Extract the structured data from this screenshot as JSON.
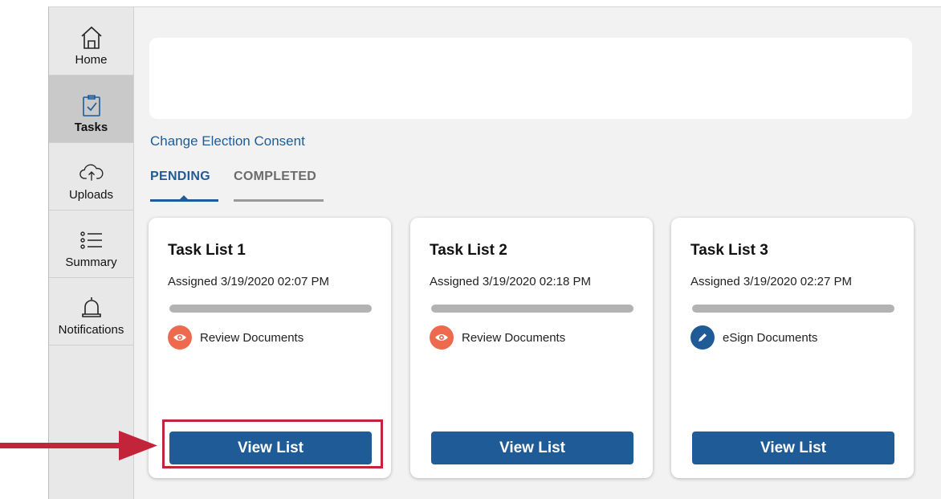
{
  "sidebar": {
    "items": [
      {
        "label": "Home",
        "icon": "home-icon",
        "active": false
      },
      {
        "label": "Tasks",
        "icon": "clipboard-check-icon",
        "active": true
      },
      {
        "label": "Uploads",
        "icon": "cloud-upload-icon",
        "active": false
      },
      {
        "label": "Summary",
        "icon": "list-icon",
        "active": false
      },
      {
        "label": "Notifications",
        "icon": "bell-icon",
        "active": false
      }
    ]
  },
  "main": {
    "consent_link": "Change Election Consent",
    "tabs": [
      {
        "label": "PENDING",
        "active": true
      },
      {
        "label": "COMPLETED",
        "active": false
      }
    ],
    "cards": [
      {
        "title": "Task List 1",
        "assigned": "Assigned 3/19/2020 02:07 PM",
        "task_label": "Review Documents",
        "task_icon": "eye-icon",
        "button": "View List"
      },
      {
        "title": "Task List 2",
        "assigned": "Assigned 3/19/2020 02:18 PM",
        "task_label": "Review Documents",
        "task_icon": "eye-icon",
        "button": "View List"
      },
      {
        "title": "Task List 3",
        "assigned": "Assigned 3/19/2020 02:27 PM",
        "task_label": "eSign Documents",
        "task_icon": "pencil-icon",
        "button": "View List"
      }
    ]
  },
  "colors": {
    "primary": "#1f5b96",
    "review_icon": "#ee6a4e",
    "highlight": "#c2243a"
  }
}
